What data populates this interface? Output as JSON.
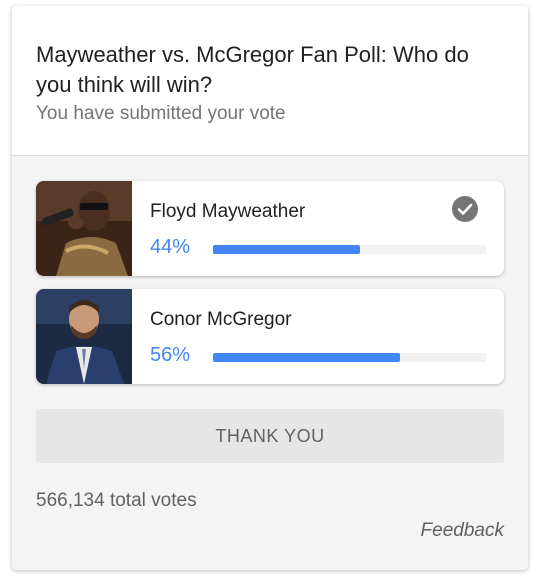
{
  "poll": {
    "title": "Mayweather vs. McGregor Fan Poll: Who do you think will win?",
    "status": "You have submitted your vote",
    "options": [
      {
        "name": "Floyd Mayweather",
        "percent_label": "44%",
        "percent": 44,
        "selected": true,
        "photo": "floyd-mayweather-photo"
      },
      {
        "name": "Conor McGregor",
        "percent_label": "56%",
        "percent": 56,
        "selected": false,
        "photo": "conor-mcgregor-photo"
      }
    ],
    "button_label": "THANK YOU",
    "total_votes": "566,134 total votes",
    "feedback_label": "Feedback"
  },
  "icons": {
    "selected": "check-circle-icon"
  },
  "colors": {
    "accent": "#4285f4",
    "check": "#757575",
    "card_bg": "#f4f4f4",
    "button_bg": "#e6e6e6"
  }
}
